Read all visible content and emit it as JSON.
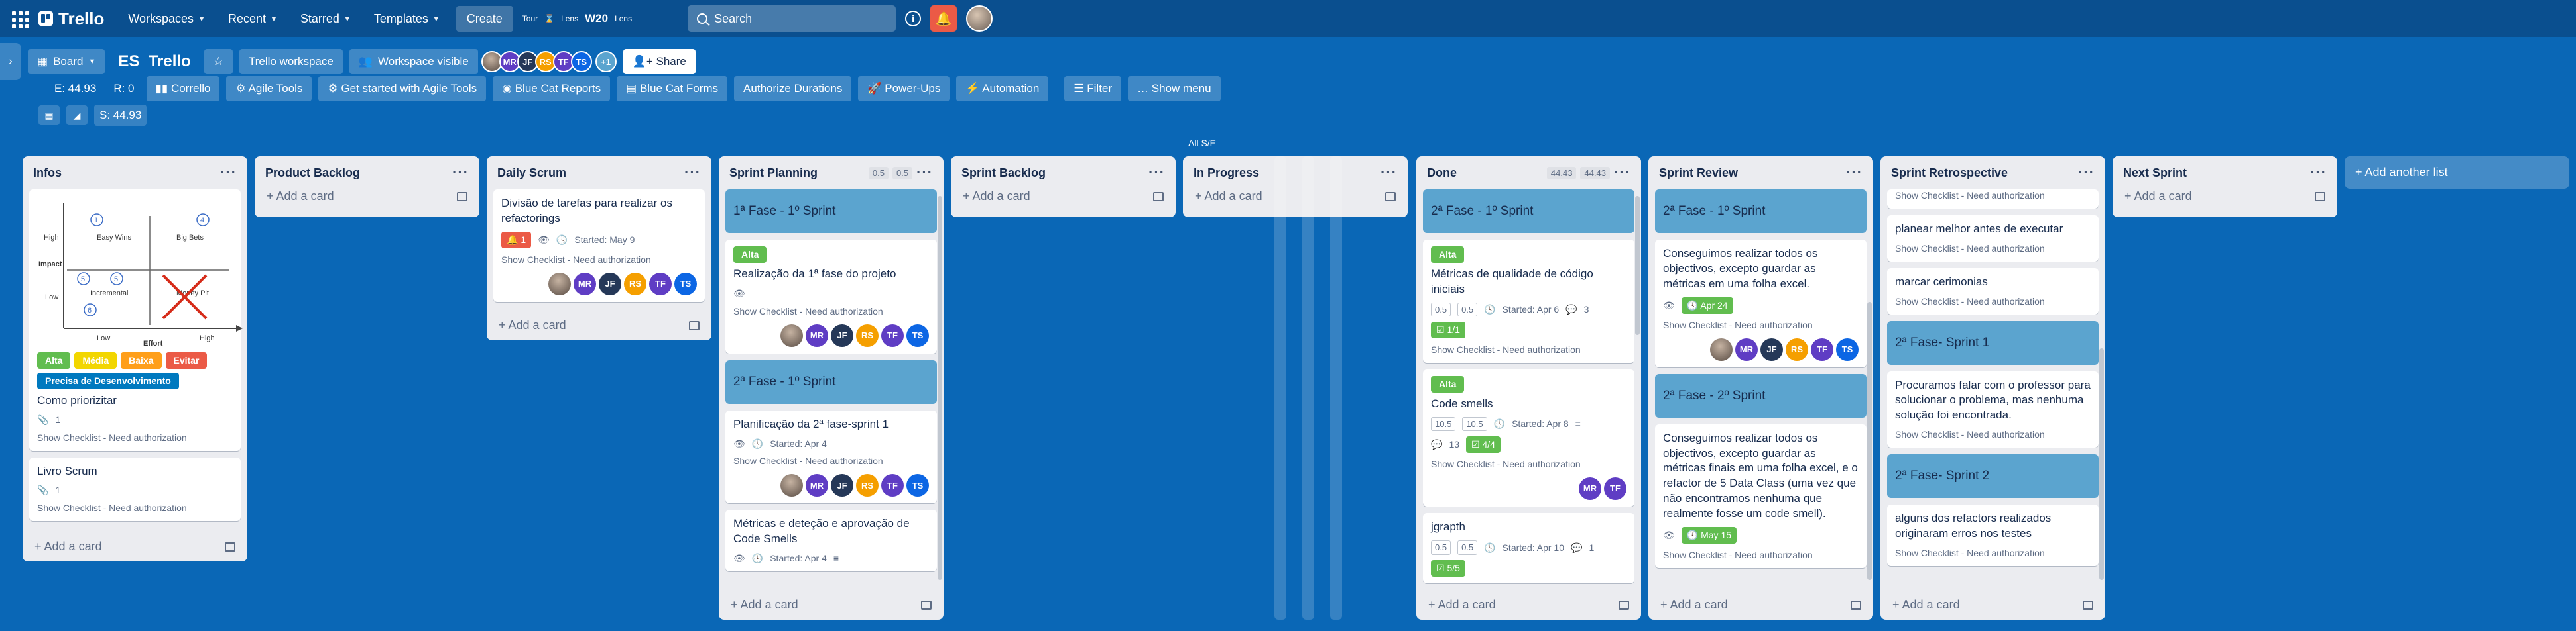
{
  "topnav": {
    "app_name": "Trello",
    "menus": [
      "Workspaces",
      "Recent",
      "Starred",
      "Templates"
    ],
    "create": "Create",
    "tour_text": "Tour",
    "tour_badge": "W20",
    "tour_small": "Lens",
    "search_placeholder": "Search"
  },
  "board": {
    "view": "Board",
    "title": "ES_Trello",
    "workspace": "Trello workspace",
    "visibility": "Workspace visible",
    "share": "Share",
    "members": [
      {
        "initials": "",
        "photo": true,
        "color": "#7a6a60"
      },
      {
        "initials": "MR",
        "color": "#5f3dc4"
      },
      {
        "initials": "JF",
        "color": "#253858"
      },
      {
        "initials": "RS",
        "color": "#f59f00"
      },
      {
        "initials": "TF",
        "color": "#5f3dc4"
      },
      {
        "initials": "TS",
        "color": "#0c66e4"
      }
    ],
    "more_members": "+1",
    "stat_e": "E: 44.93",
    "stat_r": "R: 0",
    "stat_s": "S: 44.93",
    "all_se": "All S/E",
    "toolbar": [
      "Corrello",
      "Agile Tools",
      "Get started with Agile Tools",
      "Blue Cat Reports",
      "Blue Cat Forms",
      "Authorize Durations",
      "Power-Ups",
      "Automation",
      "Filter",
      "Show menu"
    ],
    "add_list": "Add another list",
    "add_card": "Add a card"
  },
  "lists": {
    "infos": {
      "title": "Infos",
      "matrix": {
        "high": "High",
        "impact": "Impact",
        "low": "Low",
        "effort": "Effort",
        "effort_low": "Low",
        "effort_high": "High",
        "easy_wins": "Easy Wins",
        "big_bets": "Big Bets",
        "incremental": "Incremental",
        "money_pit": "Money Pit",
        "n1": "1",
        "n2": "4",
        "n3": "5",
        "n4": "6"
      },
      "labels": [
        {
          "text": "Alta",
          "color": "#61bd4f"
        },
        {
          "text": "Média",
          "color": "#f2d600"
        },
        {
          "text": "Baixa",
          "color": "#ff9f1a"
        },
        {
          "text": "Evitar",
          "color": "#eb5a46"
        },
        {
          "text": "Precisa de Desenvolvimento",
          "color": "#0079bf"
        }
      ],
      "card1_title": "Como priorizitar",
      "card1_attach": "1",
      "card1_sub": "Show Checklist - Need authorization",
      "card2_title": "Livro Scrum",
      "card2_attach": "1",
      "card2_sub": "Show Checklist - Need authorization"
    },
    "product_backlog": {
      "title": "Product Backlog"
    },
    "daily_scrum": {
      "title": "Daily Scrum",
      "card_title": "Divisão de tarefas para realizar os refactorings",
      "card_badge": "1",
      "card_started": "Started: May 9",
      "card_sub": "Show Checklist - Need authorization"
    },
    "sprint_planning": {
      "title": "Sprint Planning",
      "pill1": "0.5",
      "pill2": "0.5",
      "b1": "1ª Fase - 1º Sprint",
      "c1_label": "Alta",
      "c1_title": "Realização da 1ª fase do projeto",
      "c1_sub": "Show Checklist - Need authorization",
      "b2": "2ª Fase - 1º Sprint",
      "c2_title": "Planificação da 2ª fase-sprint 1",
      "c2_started": "Started: Apr 4",
      "c2_sub": "Show Checklist - Need authorization",
      "c3_title": "Métricas e deteção e aprovação de Code Smells",
      "c3_started": "Started: Apr 4"
    },
    "sprint_backlog": {
      "title": "Sprint Backlog"
    },
    "in_progress": {
      "title": "In Progress"
    },
    "done": {
      "title": "Done",
      "pill1": "44.43",
      "pill2": "44.43",
      "b1": "2ª Fase - 1º Sprint",
      "c1_label": "Alta",
      "c1_title": "Métricas de qualidade de código iniciais",
      "c1_n1": "0.5",
      "c1_n2": "0.5",
      "c1_started": "Started: Apr 6",
      "c1_comments": "3",
      "c1_check": "1/1",
      "c1_sub": "Show Checklist - Need authorization",
      "c2_label": "Alta",
      "c2_title": "Code smells",
      "c2_n1": "10.5",
      "c2_n2": "10.5",
      "c2_started": "Started: Apr 8",
      "c2_comments": "13",
      "c2_check": "4/4",
      "c2_sub": "Show Checklist - Need authorization",
      "c3_title": "jgrapth",
      "c3_n1": "0.5",
      "c3_n2": "0.5",
      "c3_started": "Started: Apr 10",
      "c3_comments": "1",
      "c3_check": "5/5"
    },
    "sprint_review": {
      "title": "Sprint Review",
      "b1": "2ª Fase - 1º Sprint",
      "c1_title": "Conseguimos realizar todos os objectivos, excepto guardar as métricas em uma folha excel.",
      "c1_due": "Apr 24",
      "c1_sub": "Show Checklist - Need authorization",
      "b2": "2ª Fase - 2º Sprint",
      "c2_title": "Conseguimos realizar todos os objectivos, excepto guardar as métricas finais em uma folha excel, e o refactor de 5 Data Class (uma vez que não encontramos nenhuma que realmente fosse um code smell).",
      "c2_due": "May 15",
      "c2_sub": "Show Checklist - Need authorization"
    },
    "sprint_retro": {
      "title": "Sprint Retrospective",
      "c0_sub": "Show Checklist - Need authorization",
      "c1_title": "planear melhor antes de executar",
      "c1_sub": "Show Checklist - Need authorization",
      "c2_title": "marcar cerimonias",
      "c2_sub": "Show Checklist - Need authorization",
      "b1": "2ª Fase- Sprint 1",
      "c3_title": "Procuramos falar com o professor para solucionar o problema, mas nenhuma solução foi encontrada.",
      "c3_sub": "Show Checklist - Need authorization",
      "b2": "2ª Fase- Sprint 2",
      "c4_title": "alguns dos refactors realizados originaram erros nos testes",
      "c4_sub": "Show Checklist - Need authorization"
    },
    "next_sprint": {
      "title": "Next Sprint"
    }
  },
  "colors": {
    "board_bg": "#0a67b6",
    "nav_bg": "#0a4f8f",
    "section_card": "#5ba4cf",
    "green": "#61bd4f",
    "red": "#eb5a46"
  }
}
